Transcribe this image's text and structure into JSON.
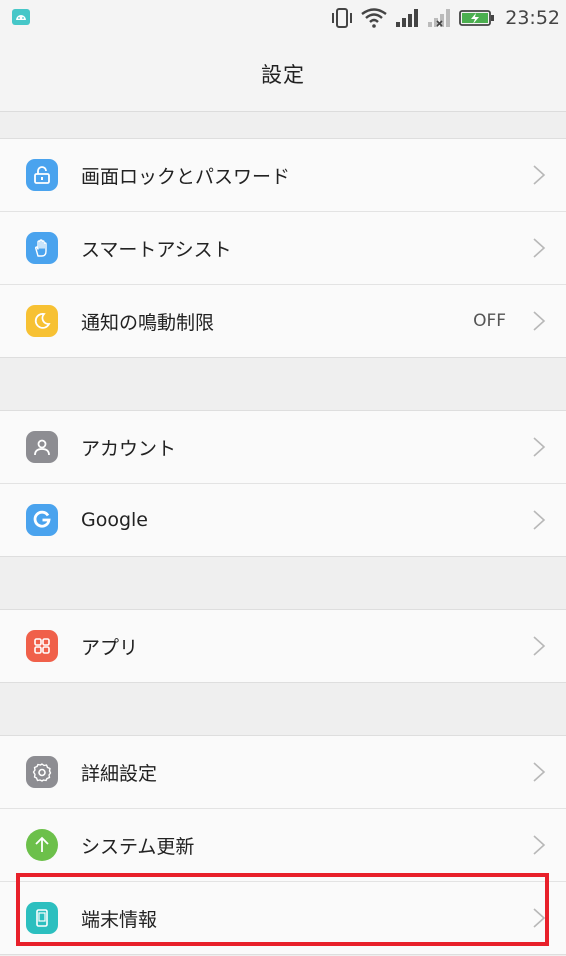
{
  "status_bar": {
    "time": "23:52",
    "icons": [
      "android-notification-icon",
      "vibrate-icon",
      "wifi-icon",
      "signal-icon",
      "no-signal-icon",
      "battery-charging-icon"
    ],
    "colors": {
      "battery": "#4caf50",
      "android_badge": "#46c7c8"
    }
  },
  "header": {
    "title": "設定"
  },
  "groups": [
    {
      "items": [
        {
          "label": "画面ロックとパスワード",
          "icon": "lock-icon",
          "color": "#4aa3ee"
        },
        {
          "label": "スマートアシスト",
          "icon": "hand-icon",
          "color": "#4aa3ee"
        },
        {
          "label": "通知の鳴動制限",
          "icon": "moon-icon",
          "color": "#f7c133",
          "value": "OFF"
        }
      ]
    },
    {
      "items": [
        {
          "label": "アカウント",
          "icon": "person-icon",
          "color": "#8d8d92"
        },
        {
          "label": "Google",
          "icon": "google-icon",
          "color": "#4aa3ee"
        }
      ]
    },
    {
      "items": [
        {
          "label": "アプリ",
          "icon": "apps-grid-icon",
          "color": "#f0604a"
        }
      ]
    },
    {
      "items": [
        {
          "label": "詳細設定",
          "icon": "gear-icon",
          "color": "#8d8d92"
        },
        {
          "label": "システム更新",
          "icon": "arrow-up-icon",
          "color": "#6cc04a"
        },
        {
          "label": "端末情報",
          "icon": "phone-info-icon",
          "color": "#2cbfbf"
        }
      ]
    }
  ],
  "highlight": {
    "color": "#e8202a",
    "target": "端末情報"
  }
}
